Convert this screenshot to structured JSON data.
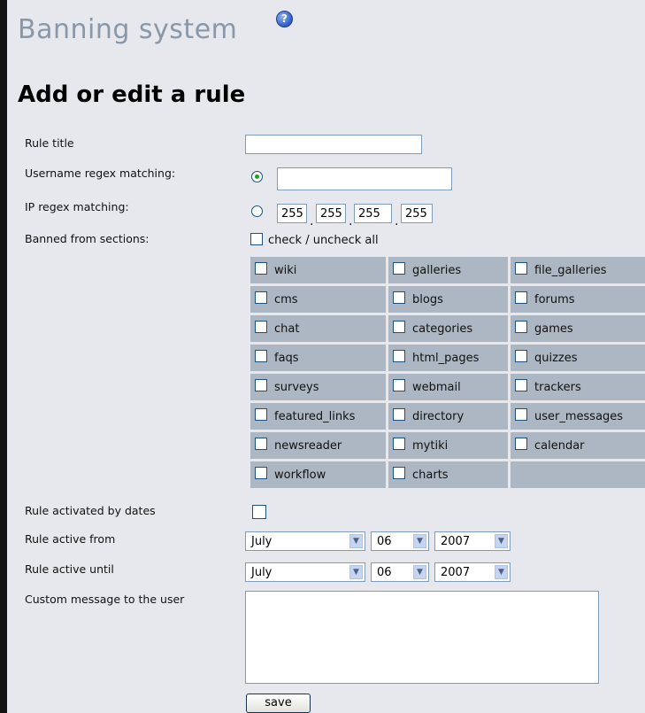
{
  "header": {
    "title": "Banning system",
    "help_icon": "help-icon"
  },
  "form": {
    "heading": "Add or edit a rule",
    "labels": {
      "rule_title": "Rule title",
      "username_regex": "Username regex matching:",
      "ip_regex": "IP regex matching:",
      "banned_sections": "Banned from sections:",
      "activated_by_dates": "Rule activated by dates",
      "active_from": "Rule active from",
      "active_until": "Rule active until",
      "custom_message": "Custom message to the user"
    },
    "rule_title_value": "",
    "username_regex_value": "",
    "match_mode_selected": "username",
    "ip": [
      "255",
      "255",
      "255",
      "255"
    ],
    "ip_separator": ".",
    "check_all_label": "check / uncheck all",
    "sections": [
      "wiki",
      "galleries",
      "file_galleries",
      "cms",
      "blogs",
      "forums",
      "chat",
      "categories",
      "games",
      "faqs",
      "html_pages",
      "quizzes",
      "surveys",
      "webmail",
      "trackers",
      "featured_links",
      "directory",
      "user_messages",
      "newsreader",
      "mytiki",
      "calendar",
      "workflow",
      "charts"
    ],
    "dates_checked": false,
    "active_from": {
      "month": "July",
      "day": "06",
      "year": "2007"
    },
    "active_until": {
      "month": "July",
      "day": "06",
      "year": "2007"
    },
    "custom_message_value": "",
    "save_label": "save"
  },
  "colors": {
    "page_bg": "#e6e8ee",
    "grid_cell": "#adb7c3",
    "title": "#8a97a8"
  }
}
